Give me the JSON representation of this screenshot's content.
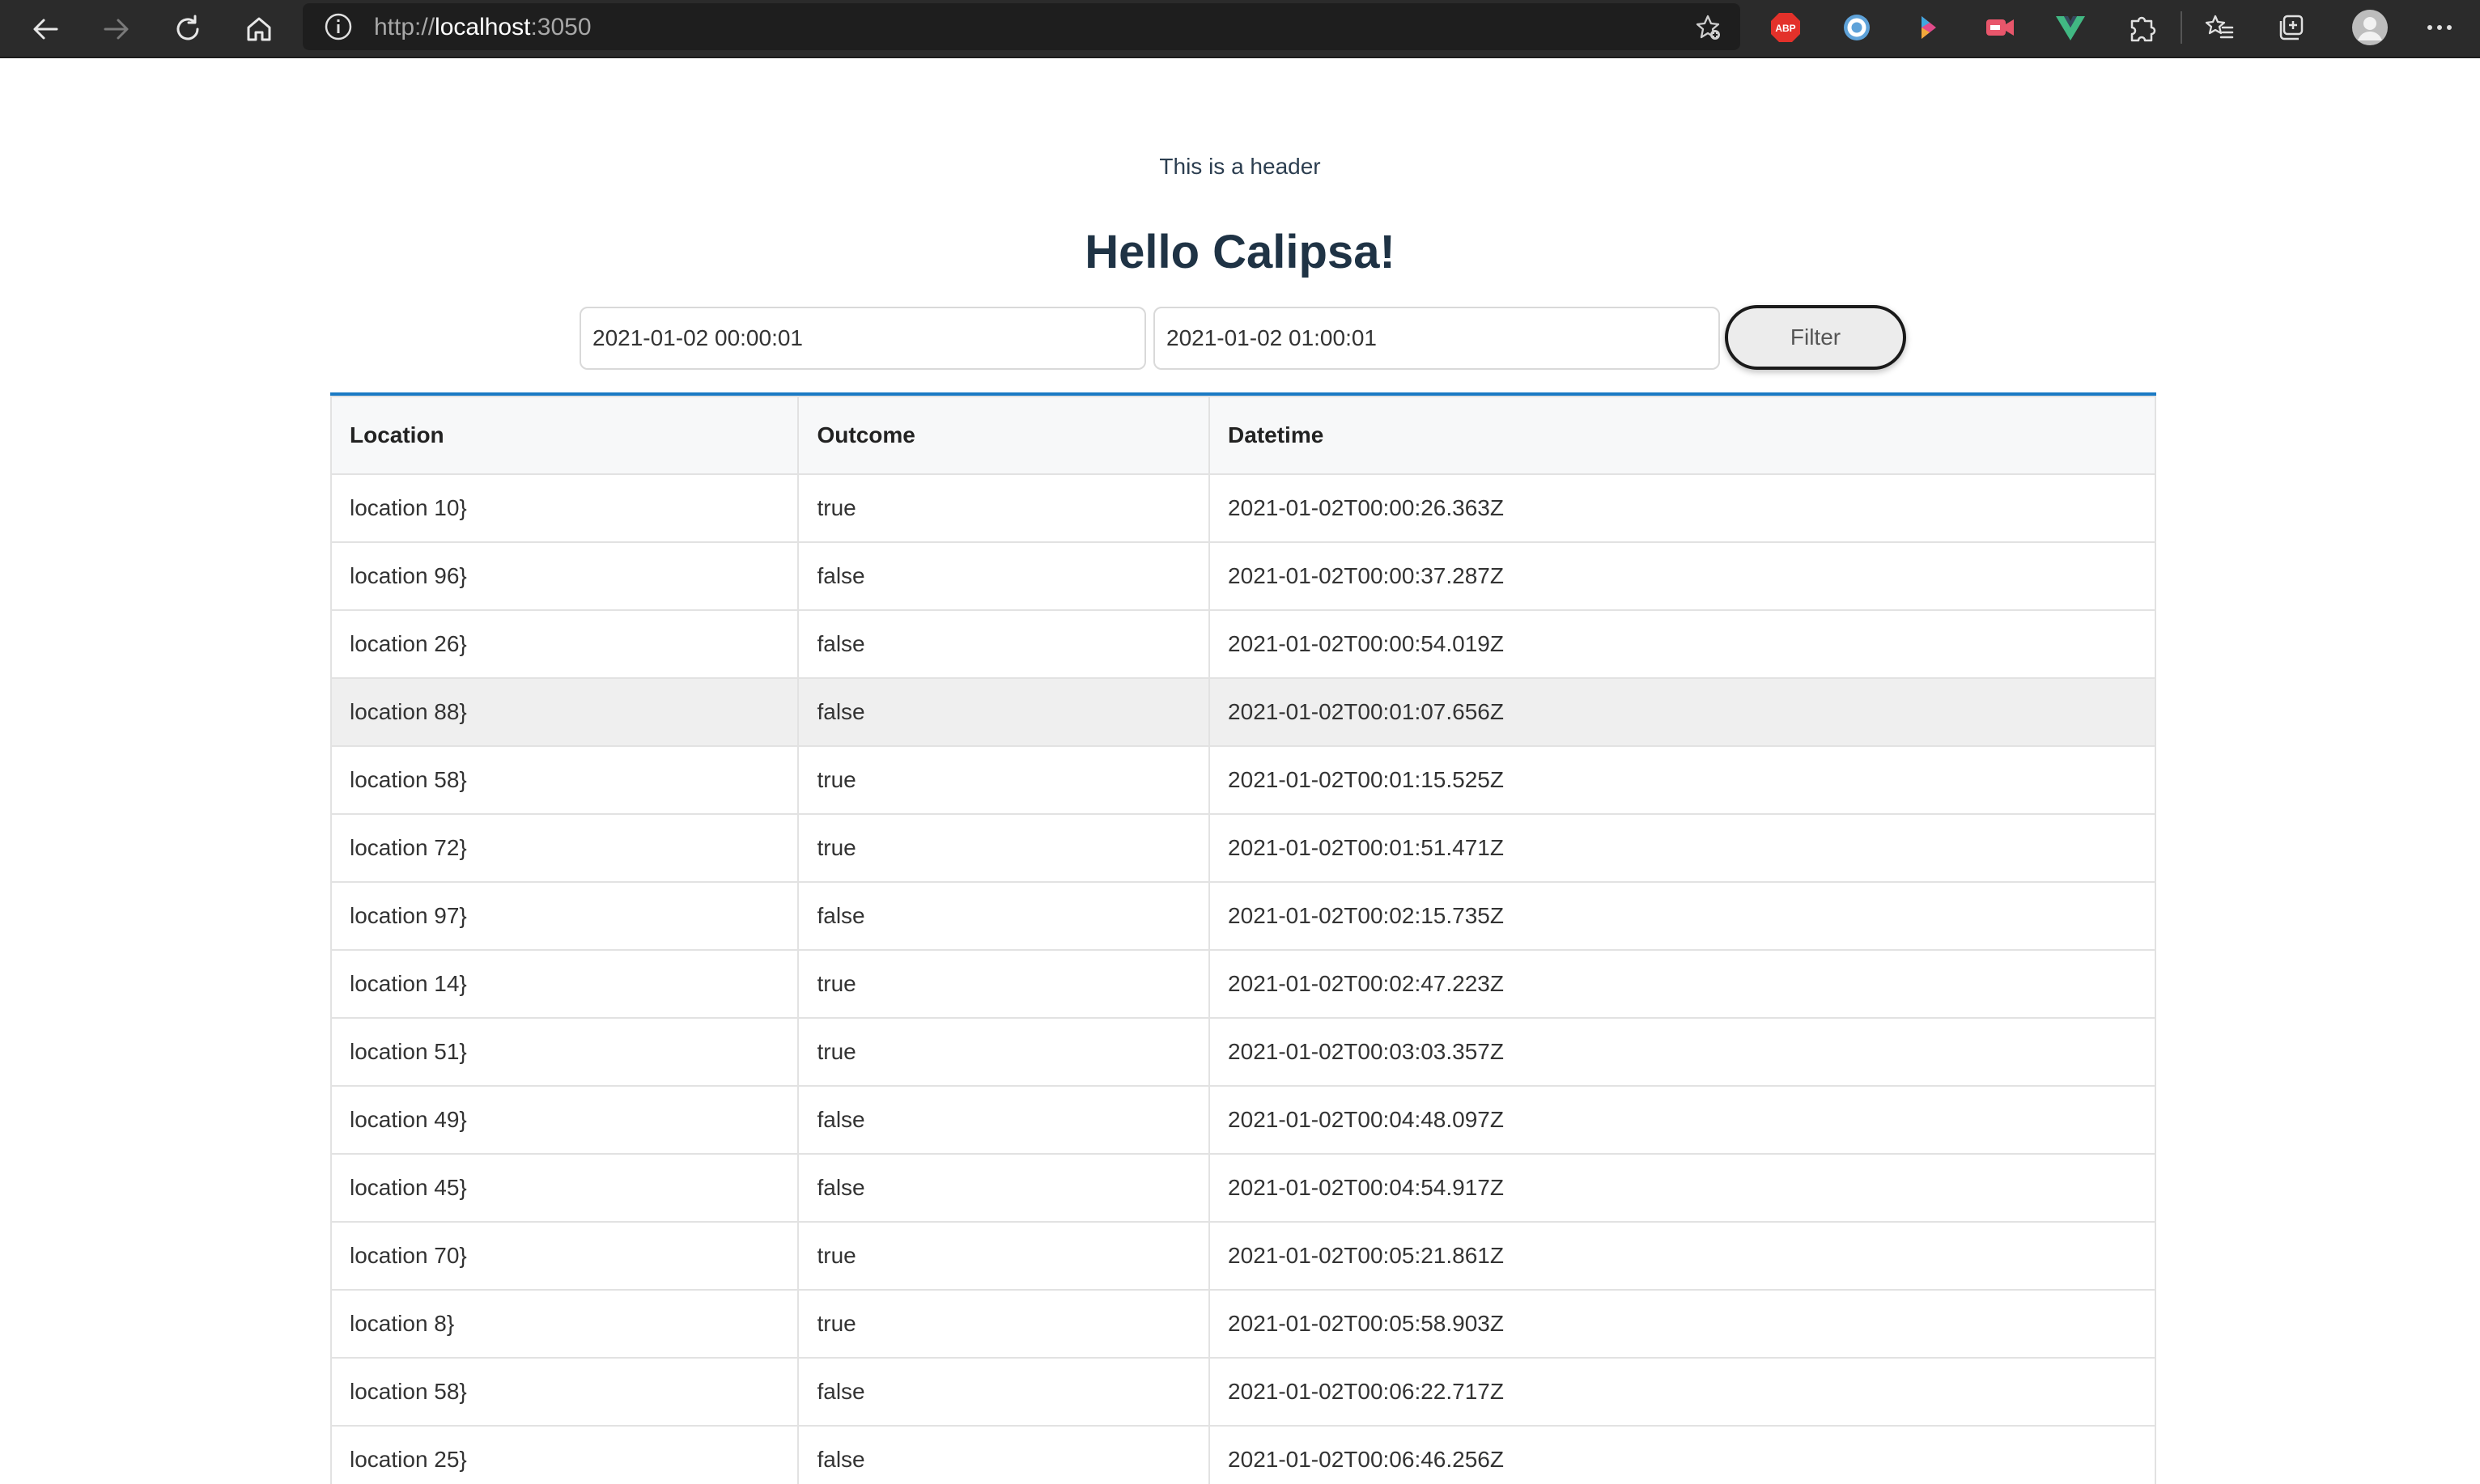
{
  "browser": {
    "url_scheme": "http://",
    "url_host": "localhost",
    "url_port": ":3050",
    "nav": [
      "back-icon",
      "forward-icon",
      "reload-icon",
      "home-icon"
    ],
    "extensions": [
      "adblock-plus-icon",
      "ring-extension-icon",
      "dart-extension-icon",
      "camera-extension-icon",
      "vue-devtools-icon",
      "puzzle-extensions-icon",
      "favorites-icon",
      "collections-icon",
      "profile-avatar-icon",
      "more-menu-icon"
    ],
    "adblock_label": "ABP"
  },
  "page": {
    "header_text": "This is a header",
    "title": "Hello Calipsa!",
    "filter": {
      "start_value": "2021-01-02 00:00:01",
      "end_value": "2021-01-02 01:00:01",
      "button_label": "Filter"
    }
  },
  "table": {
    "headers": [
      "Location",
      "Outcome",
      "Datetime"
    ],
    "highlighted_row": 3,
    "rows": [
      [
        "location 10}",
        "true",
        "2021-01-02T00:00:26.363Z"
      ],
      [
        "location 96}",
        "false",
        "2021-01-02T00:00:37.287Z"
      ],
      [
        "location 26}",
        "false",
        "2021-01-02T00:00:54.019Z"
      ],
      [
        "location 88}",
        "false",
        "2021-01-02T00:01:07.656Z"
      ],
      [
        "location 58}",
        "true",
        "2021-01-02T00:01:15.525Z"
      ],
      [
        "location 72}",
        "true",
        "2021-01-02T00:01:51.471Z"
      ],
      [
        "location 97}",
        "false",
        "2021-01-02T00:02:15.735Z"
      ],
      [
        "location 14}",
        "true",
        "2021-01-02T00:02:47.223Z"
      ],
      [
        "location 51}",
        "true",
        "2021-01-02T00:03:03.357Z"
      ],
      [
        "location 49}",
        "false",
        "2021-01-02T00:04:48.097Z"
      ],
      [
        "location 45}",
        "false",
        "2021-01-02T00:04:54.917Z"
      ],
      [
        "location 70}",
        "true",
        "2021-01-02T00:05:21.861Z"
      ],
      [
        "location 8}",
        "true",
        "2021-01-02T00:05:58.903Z"
      ],
      [
        "location 58}",
        "false",
        "2021-01-02T00:06:22.717Z"
      ],
      [
        "location 25}",
        "false",
        "2021-01-02T00:06:46.256Z"
      ]
    ]
  },
  "colors": {
    "chrome_bg": "#2b2b2b",
    "table_accent": "#1a7ac4",
    "title": "#1f3345",
    "highlight_row": "#efefef"
  }
}
